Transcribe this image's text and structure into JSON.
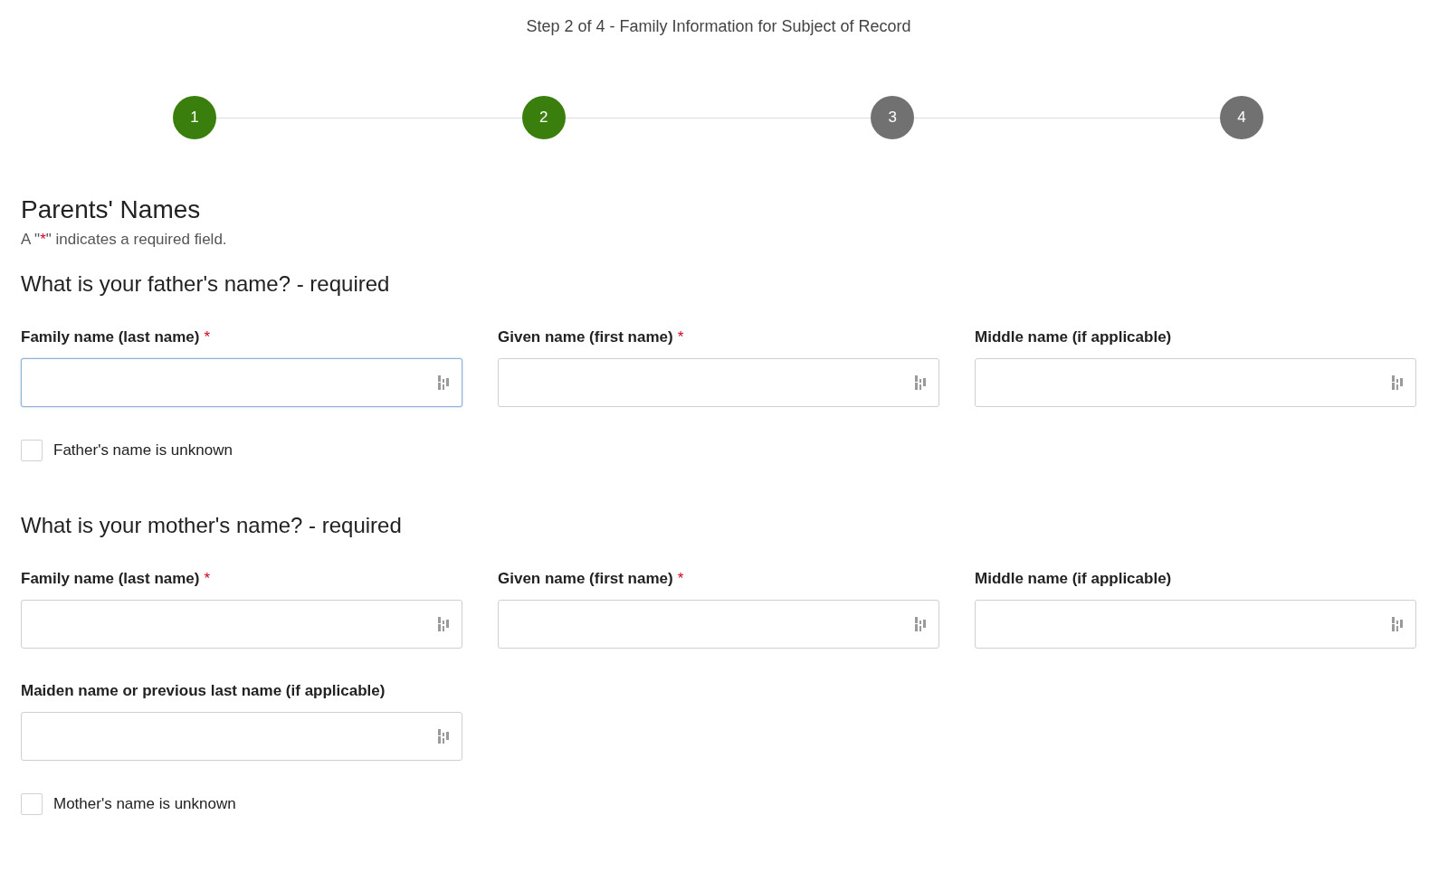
{
  "header": {
    "title": "Step 2 of 4 - Family Information for Subject of Record"
  },
  "steps": [
    {
      "label": "1",
      "completed": true
    },
    {
      "label": "2",
      "completed": true
    },
    {
      "label": "3",
      "completed": false
    },
    {
      "label": "4",
      "completed": false
    }
  ],
  "section": {
    "heading": "Parents' Names",
    "note": {
      "before": "A \"",
      "mark": "*",
      "after": "\" indicates a required field."
    }
  },
  "groups": [
    {
      "question": "What is your father's name? - required",
      "fields": [
        {
          "label": "Family name (last name)",
          "required_mark": "*",
          "focused": true
        },
        {
          "label": "Given name (first name)",
          "required_mark": "*",
          "focused": false
        },
        {
          "label": "Middle name (if applicable)",
          "focused": false
        }
      ],
      "unknown_option": {
        "label": "Father's name is unknown",
        "checked": false
      }
    },
    {
      "question": "What is your mother's name? - required",
      "fields": [
        {
          "label": "Family name (last name)",
          "required_mark": "*",
          "focused": false
        },
        {
          "label": "Given name (first name)",
          "required_mark": "*",
          "focused": false
        },
        {
          "label": "Middle name (if applicable)",
          "focused": false
        },
        {
          "label": "Maiden name or previous last name (if applicable)",
          "focused": false
        }
      ],
      "unknown_option": {
        "label": "Mother's name is unknown",
        "checked": false
      }
    }
  ]
}
